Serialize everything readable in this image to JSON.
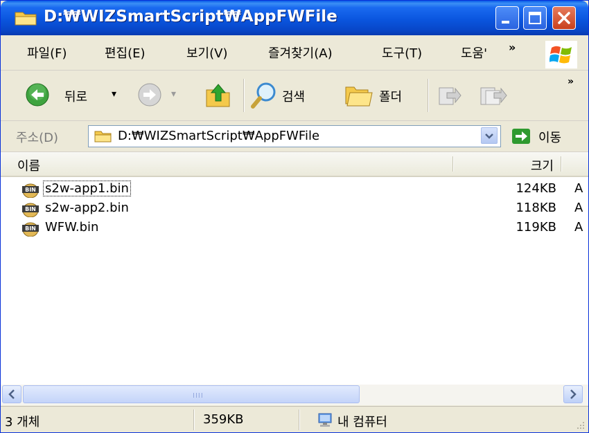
{
  "window": {
    "title": "D:₩WIZSmartScript₩AppFWFile",
    "controls": [
      "minimize-icon",
      "maximize-icon",
      "close-icon"
    ],
    "title_bar_color": "#0a55de"
  },
  "menu": {
    "items": [
      {
        "label": "파일(F)"
      },
      {
        "label": "편집(E)"
      },
      {
        "label": "보기(V)"
      },
      {
        "label": "즐겨찾기(A)"
      },
      {
        "label": "도구(T)"
      },
      {
        "label": "도움'"
      }
    ],
    "more": "»"
  },
  "toolbar": {
    "back_label": "뒤로",
    "back_dropdown": "▾",
    "forward_dropdown": "▾",
    "search_label": "검색",
    "folders_label": "폴더",
    "more": "»"
  },
  "address": {
    "label": "주소(D)",
    "value": "D:₩WIZSmartScript₩AppFWFile",
    "go_label": "이동"
  },
  "list": {
    "columns": {
      "name": "이름",
      "size": "크기"
    },
    "files": [
      {
        "name": "s2w-app1.bin",
        "size": "124KB",
        "type": "A",
        "icon": "bin-file-icon"
      },
      {
        "name": "s2w-app2.bin",
        "size": "118KB",
        "type": "A",
        "icon": "bin-file-icon"
      },
      {
        "name": "WFW.bin",
        "size": "119KB",
        "type": "A",
        "icon": "bin-file-icon"
      }
    ]
  },
  "scrollbar": {
    "grip": "IIII"
  },
  "status": {
    "count": "3 개체",
    "size": "359KB",
    "location": "내 컴퓨터"
  },
  "colors": {
    "accent": "#0a55de",
    "close": "#c8401d",
    "go_green": "#2f9a2f"
  }
}
